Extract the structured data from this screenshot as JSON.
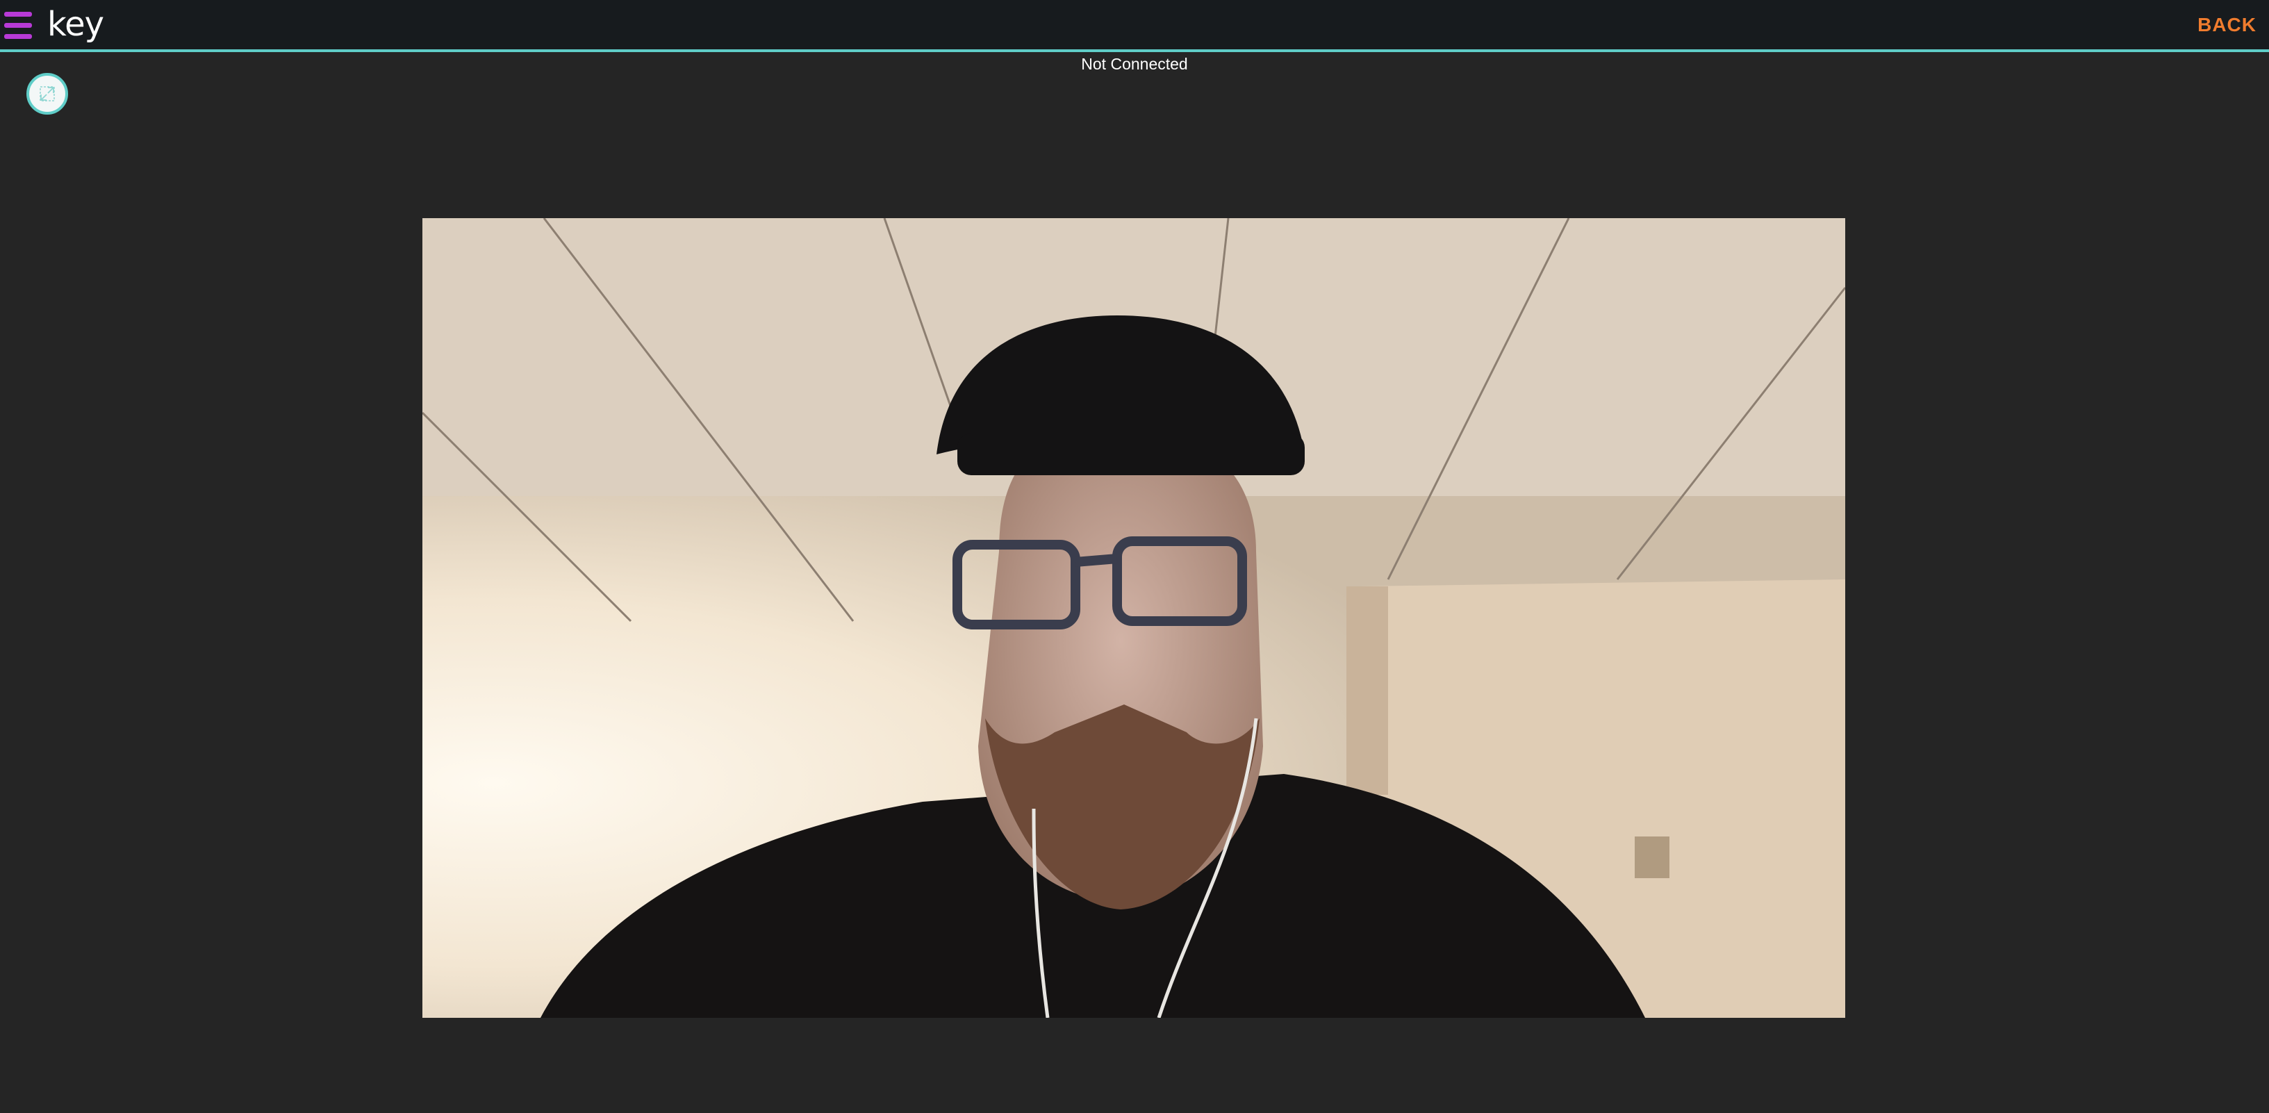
{
  "header": {
    "logo_text": "key",
    "back_label": "BACK",
    "menu_icon": "hamburger-menu-icon",
    "accent_color": "#5fcdc8",
    "menu_color": "#b73ad6",
    "back_color": "#f07c2e"
  },
  "call": {
    "status_text": "Not Connected",
    "fullscreen_icon": "expand-icon"
  }
}
